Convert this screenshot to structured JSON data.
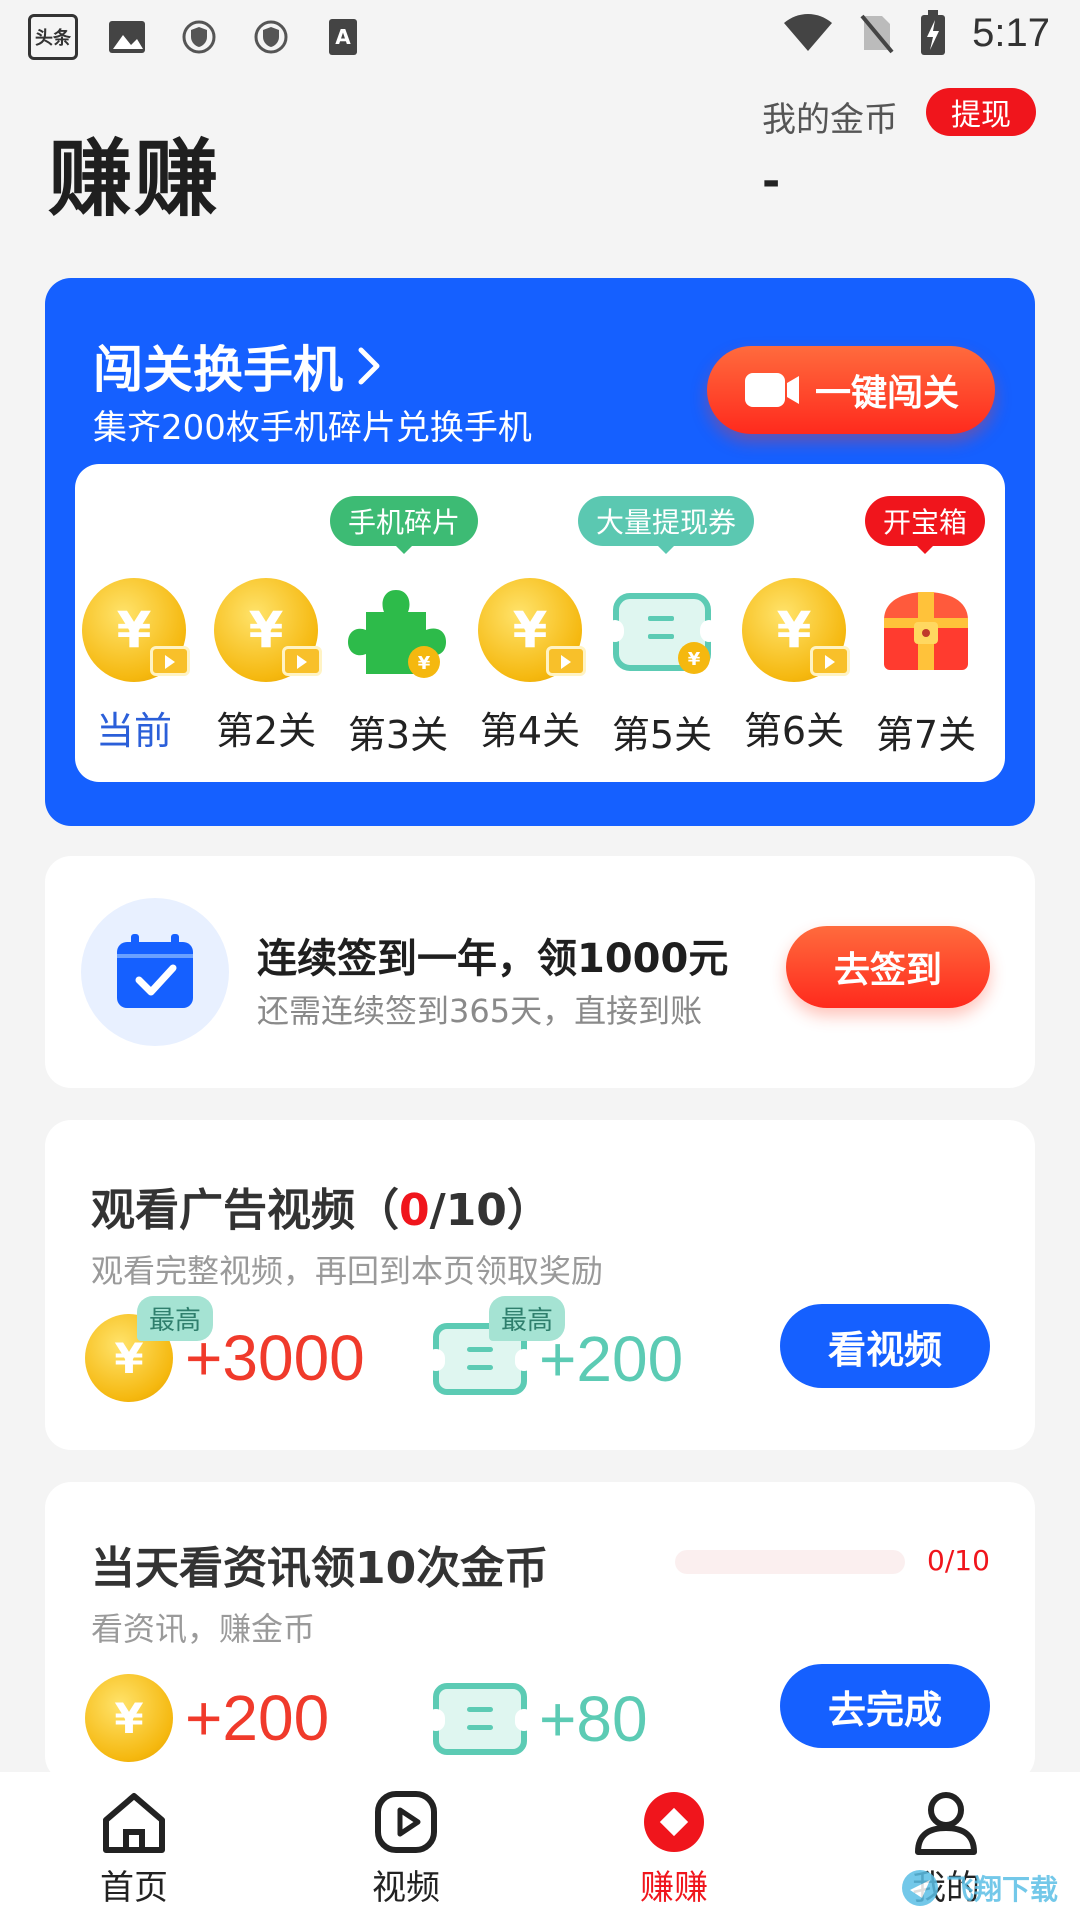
{
  "status_bar": {
    "time": "5:17",
    "app_icon_text": "头条"
  },
  "header": {
    "title": "赚赚",
    "coin_label": "我的金币",
    "withdraw_label": "提现",
    "coin_value": "-"
  },
  "promo": {
    "title": "闯关换手机",
    "subtitle": "集齐200枚手机碎片兑换手机",
    "button_label": "一键闯关",
    "stages": [
      {
        "label": "当前",
        "icon": "gold-coin-video-icon",
        "tag": ""
      },
      {
        "label": "第2关",
        "icon": "gold-coin-video-icon",
        "tag": ""
      },
      {
        "label": "第3关",
        "icon": "puzzle-piece-icon",
        "tag": "手机碎片"
      },
      {
        "label": "第4关",
        "icon": "gold-coin-video-icon",
        "tag": ""
      },
      {
        "label": "第5关",
        "icon": "coupon-ticket-icon",
        "tag": "大量提现券"
      },
      {
        "label": "第6关",
        "icon": "gold-coin-video-icon",
        "tag": ""
      },
      {
        "label": "第7关",
        "icon": "treasure-chest-icon",
        "tag": "开宝箱"
      }
    ]
  },
  "checkin": {
    "title": "连续签到一年，领1000元",
    "subtitle": "还需连续签到365天，直接到账",
    "button_label": "去签到"
  },
  "video_task": {
    "title_prefix": "观看广告视频（",
    "done": "0",
    "title_suffix": "/10）",
    "subtitle": "观看完整视频，再回到本页领取奖励",
    "badge": "最高",
    "coin_reward": "+3000",
    "ticket_reward": "+200",
    "button_label": "看视频"
  },
  "news_task": {
    "title": "当天看资讯领10次金币",
    "subtitle": "看资讯，赚金币",
    "progress_text": "0/10",
    "progress_fraction": 0,
    "coin_reward": "+200",
    "ticket_reward": "+80",
    "button_label": "去完成"
  },
  "tabbar": {
    "items": [
      {
        "label": "首页",
        "icon": "home-icon"
      },
      {
        "label": "视频",
        "icon": "video-play-icon"
      },
      {
        "label": "赚赚",
        "icon": "earn-diamond-icon"
      },
      {
        "label": "我的",
        "icon": "profile-icon"
      }
    ]
  },
  "watermark": "飞翔下载",
  "colors": {
    "brand_blue": "#1560ff",
    "accent_red": "#f0151c",
    "coin_gold": "#f5b80f",
    "ticket_teal": "#5ccbb4"
  }
}
